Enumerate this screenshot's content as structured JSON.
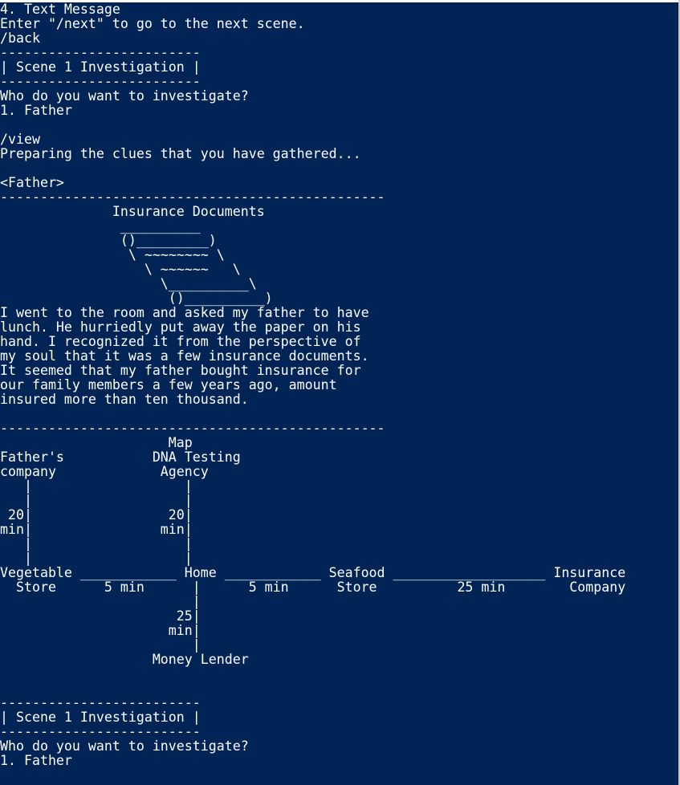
{
  "theme": {
    "background": "#012456",
    "foreground": "#ffffff"
  },
  "console": {
    "lines": [
      "4. Text Message",
      "Enter \"/next\" to go to the next scene.",
      "/back",
      "-------------------------",
      "| Scene 1 Investigation |",
      "-------------------------",
      "Who do you want to investigate?",
      "1. Father",
      "",
      "/view",
      "Preparing the clues that you have gathered...",
      "",
      "<Father>",
      "------------------------------------------------",
      "              Insurance Documents",
      "               __________",
      "               ()_________)",
      "                \\ ~~~~~~~~ \\",
      "                  \\ ~~~~~~   \\",
      "                    \\__________\\",
      "                     ()__________)",
      "I went to the room and asked my father to have",
      "lunch. He hurriedly put away the paper on his",
      "hand. I recognized it from the perspective of",
      "my soul that it was a few insurance documents.",
      "It seemed that my father bought insurance for",
      "our family members a few years ago, amount",
      "insured more than ten thousand.",
      "",
      "------------------------------------------------",
      "                     Map",
      "Father's           DNA Testing",
      "company             Agency",
      "   |                   |",
      "   |                   |",
      " 20|                 20|",
      "min|                min|",
      "   |                   |",
      "   |                   |",
      "Vegetable ____________ Home ____________ Seafood ___________________ Insurance",
      "  Store      5 min      |      5 min      Store          25 min        Company",
      "                        |",
      "                      25|",
      "                     min|",
      "                        |",
      "                   Money Lender",
      "",
      "",
      "-------------------------",
      "| Scene 1 Investigation |",
      "-------------------------",
      "Who do you want to investigate?",
      "1. Father"
    ]
  }
}
